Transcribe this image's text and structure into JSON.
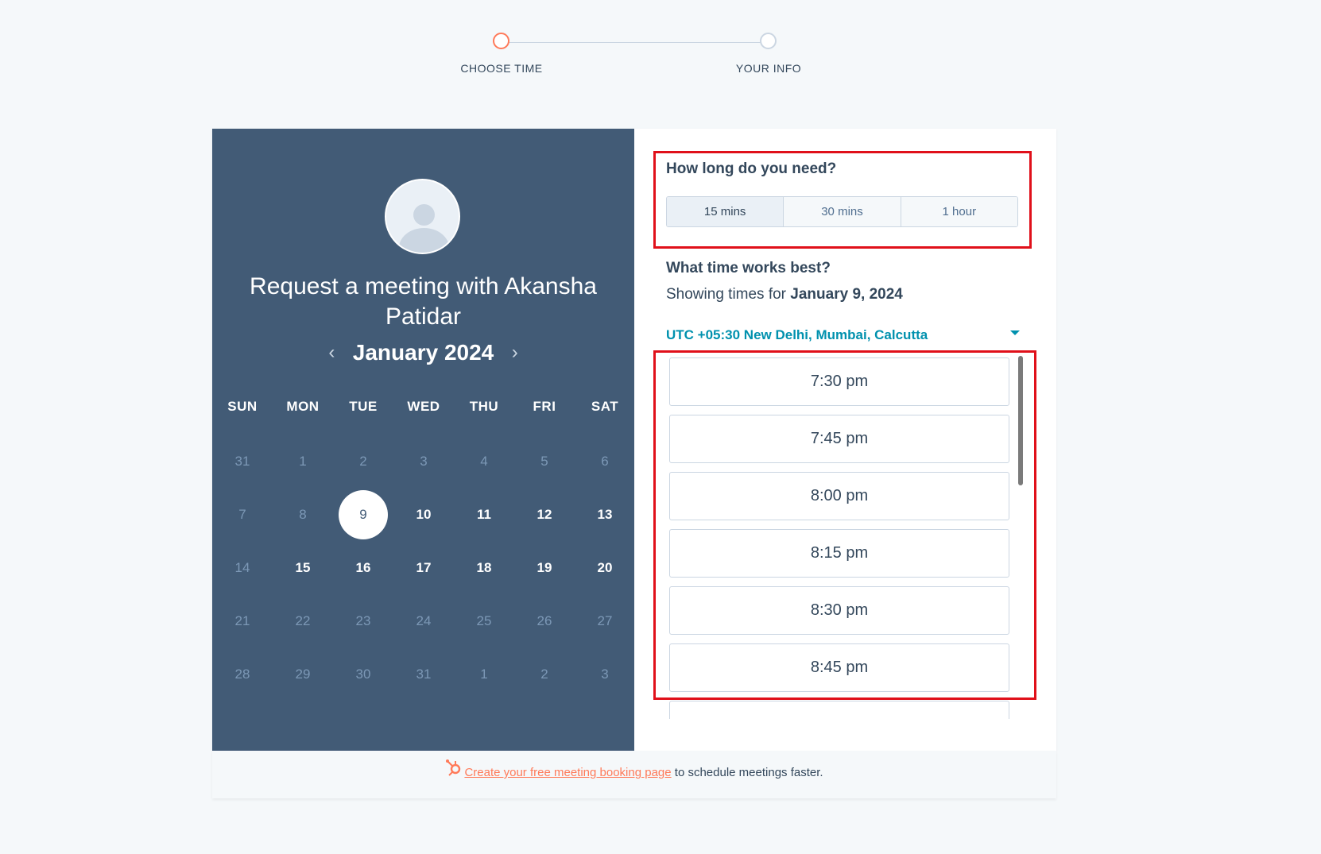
{
  "stepper": {
    "steps": [
      {
        "label": "CHOOSE TIME",
        "state": "active"
      },
      {
        "label": "YOUR INFO",
        "state": "inactive"
      }
    ]
  },
  "profile": {
    "title": "Request a meeting with Akansha Patidar"
  },
  "calendar": {
    "month_label": "January 2024",
    "prev_icon": "chevron-left-icon",
    "next_icon": "chevron-right-icon",
    "weekdays": [
      "SUN",
      "MON",
      "TUE",
      "WED",
      "THU",
      "FRI",
      "SAT"
    ],
    "weeks": [
      [
        {
          "d": "31",
          "s": "muted"
        },
        {
          "d": "1",
          "s": "muted"
        },
        {
          "d": "2",
          "s": "muted"
        },
        {
          "d": "3",
          "s": "muted"
        },
        {
          "d": "4",
          "s": "muted"
        },
        {
          "d": "5",
          "s": "muted"
        },
        {
          "d": "6",
          "s": "muted"
        }
      ],
      [
        {
          "d": "7",
          "s": "muted"
        },
        {
          "d": "8",
          "s": "muted"
        },
        {
          "d": "9",
          "s": "selected"
        },
        {
          "d": "10",
          "s": "avail"
        },
        {
          "d": "11",
          "s": "avail"
        },
        {
          "d": "12",
          "s": "avail"
        },
        {
          "d": "13",
          "s": "avail"
        }
      ],
      [
        {
          "d": "14",
          "s": "muted"
        },
        {
          "d": "15",
          "s": "avail"
        },
        {
          "d": "16",
          "s": "avail"
        },
        {
          "d": "17",
          "s": "avail"
        },
        {
          "d": "18",
          "s": "avail"
        },
        {
          "d": "19",
          "s": "avail"
        },
        {
          "d": "20",
          "s": "avail"
        }
      ],
      [
        {
          "d": "21",
          "s": "muted"
        },
        {
          "d": "22",
          "s": "muted"
        },
        {
          "d": "23",
          "s": "muted"
        },
        {
          "d": "24",
          "s": "muted"
        },
        {
          "d": "25",
          "s": "muted"
        },
        {
          "d": "26",
          "s": "muted"
        },
        {
          "d": "27",
          "s": "muted"
        }
      ],
      [
        {
          "d": "28",
          "s": "muted"
        },
        {
          "d": "29",
          "s": "muted"
        },
        {
          "d": "30",
          "s": "muted"
        },
        {
          "d": "31",
          "s": "muted"
        },
        {
          "d": "1",
          "s": "muted"
        },
        {
          "d": "2",
          "s": "muted"
        },
        {
          "d": "3",
          "s": "muted"
        }
      ]
    ]
  },
  "duration": {
    "title": "How long do you need?",
    "options": [
      "15 mins",
      "30 mins",
      "1 hour"
    ],
    "selected": "15 mins"
  },
  "times": {
    "title": "What time works best?",
    "showing_prefix": "Showing times for",
    "showing_date": "January 9, 2024",
    "timezone": "UTC +05:30 New Delhi, Mumbai, Calcutta",
    "slots": [
      "7:30 pm",
      "7:45 pm",
      "8:00 pm",
      "8:15 pm",
      "8:30 pm",
      "8:45 pm",
      ""
    ]
  },
  "footer": {
    "link_text": "Create your free meeting booking page",
    "suffix": "to schedule meetings faster.",
    "icon": "hubspot-sprocket-icon"
  },
  "colors": {
    "left_panel": "#425b76",
    "accent": "#ff7a59",
    "timezone": "#0091ae",
    "highlight": "#e0101a"
  }
}
